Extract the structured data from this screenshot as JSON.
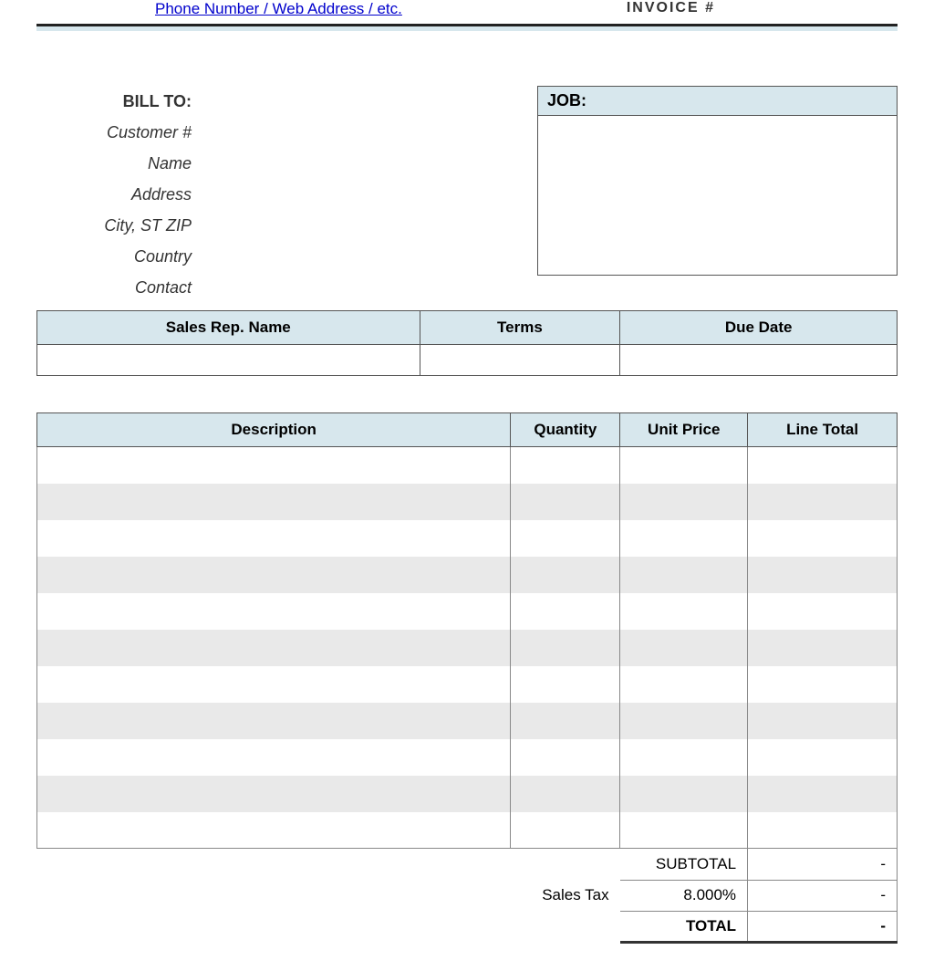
{
  "header": {
    "link_text": "Phone Number / Web Address / etc.",
    "right_text": "INVOICE #"
  },
  "bill_to": {
    "title": "BILL TO:",
    "fields": [
      "Customer #",
      "Name",
      "Address",
      "City, ST ZIP",
      "Country",
      "Contact"
    ]
  },
  "job": {
    "title": "JOB:"
  },
  "meta": {
    "headers": [
      "Sales Rep. Name",
      "Terms",
      "Due Date"
    ],
    "values": [
      "",
      "",
      ""
    ]
  },
  "items": {
    "headers": [
      "Description",
      "Quantity",
      "Unit Price",
      "Line Total"
    ],
    "rows": [
      {
        "d": "",
        "q": "",
        "u": "",
        "t": ""
      },
      {
        "d": "",
        "q": "",
        "u": "",
        "t": ""
      },
      {
        "d": "",
        "q": "",
        "u": "",
        "t": ""
      },
      {
        "d": "",
        "q": "",
        "u": "",
        "t": ""
      },
      {
        "d": "",
        "q": "",
        "u": "",
        "t": ""
      },
      {
        "d": "",
        "q": "",
        "u": "",
        "t": ""
      },
      {
        "d": "",
        "q": "",
        "u": "",
        "t": ""
      },
      {
        "d": "",
        "q": "",
        "u": "",
        "t": ""
      },
      {
        "d": "",
        "q": "",
        "u": "",
        "t": ""
      },
      {
        "d": "",
        "q": "",
        "u": "",
        "t": ""
      },
      {
        "d": "",
        "q": "",
        "u": "",
        "t": ""
      }
    ]
  },
  "totals": {
    "subtotal_label": "SUBTOTAL",
    "subtotal_value": "-",
    "tax_label": "Sales Tax",
    "tax_rate": "8.000%",
    "tax_value": "-",
    "total_label": "TOTAL",
    "total_value": "-"
  }
}
